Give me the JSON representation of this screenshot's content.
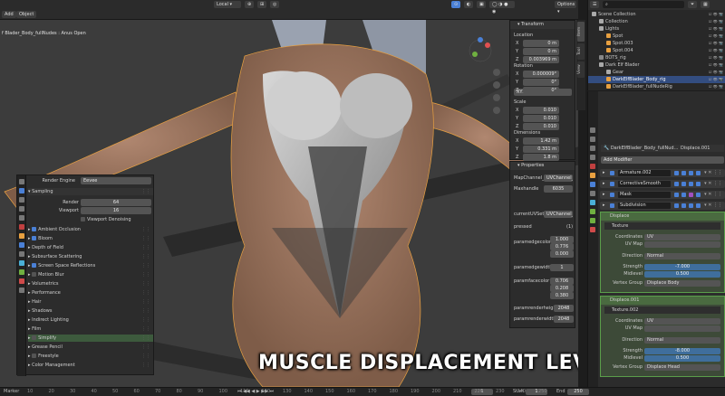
{
  "header": {
    "menu_add": "Add",
    "menu_object": "Object",
    "transform_orientation": "Local",
    "options_label": "Options"
  },
  "viewport": {
    "object_label": "f Blader_Body_fullNudes : Anus Open"
  },
  "render_panel": {
    "engine_label": "Render Engine",
    "engine_value": "Eevee",
    "sampling_header": "Sampling",
    "render_label": "Render",
    "render_value": "64",
    "viewport_label": "Viewport",
    "viewport_value": "16",
    "denoising_label": "Viewport Denoising",
    "sections": [
      {
        "label": "Ambient Occlusion",
        "check": true
      },
      {
        "label": "Bloom",
        "check": true
      },
      {
        "label": "Depth of Field",
        "check": null
      },
      {
        "label": "Subsurface Scattering",
        "check": null
      },
      {
        "label": "Screen Space Reflections",
        "check": true
      },
      {
        "label": "Motion Blur",
        "check": false
      },
      {
        "label": "Volumetrics",
        "check": null
      },
      {
        "label": "Performance",
        "check": null
      },
      {
        "label": "Hair",
        "check": null
      },
      {
        "label": "Shadows",
        "check": null
      },
      {
        "label": "Indirect Lighting",
        "check": null
      },
      {
        "label": "Film",
        "check": null
      },
      {
        "label": "Simplify",
        "check": false,
        "highlight": true
      },
      {
        "label": "Grease Pencil",
        "check": null
      },
      {
        "label": "Freestyle",
        "check": false
      },
      {
        "label": "Color Management",
        "check": null
      }
    ]
  },
  "transform_panel": {
    "title": "Transform",
    "location_label": "Location",
    "location": [
      {
        "axis": "X",
        "value": "0 m"
      },
      {
        "axis": "Y",
        "value": "0 m"
      },
      {
        "axis": "Z",
        "value": "0.003969 m"
      }
    ],
    "rotation_label": "Rotation",
    "rotation": [
      {
        "axis": "X",
        "value": "0.000009°"
      },
      {
        "axis": "Y",
        "value": "0°"
      },
      {
        "axis": "Z",
        "value": "0°"
      }
    ],
    "euler_label": "XYZ Euler",
    "scale_label": "Scale",
    "scale": [
      {
        "axis": "X",
        "value": "0.010"
      },
      {
        "axis": "Y",
        "value": "0.010"
      },
      {
        "axis": "Z",
        "value": "0.010"
      }
    ],
    "dimensions_label": "Dimensions",
    "dimensions": [
      {
        "axis": "X",
        "value": "1.42 m"
      },
      {
        "axis": "Y",
        "value": "0.331 m"
      },
      {
        "axis": "Z",
        "value": "1.8 m"
      }
    ]
  },
  "properties_panel": {
    "title": "Properties",
    "map_channel_label": "MapChannel_1",
    "map_channel_value": "UVChannel_1",
    "max_handle_label": "Maxhandle",
    "max_handle_value": "6035",
    "current_uvset_label": "currentUVSet",
    "current_uvset_value": "UVChannel_1",
    "pressed_label": "pressed",
    "pressed_value": "(1)",
    "param_model_color_label": "paramedgecolor",
    "param_model_color": [
      "1.000",
      "0.776",
      "0.000"
    ],
    "param_edge_width_label": "paramedgewidth",
    "param_edge_width_value": "1",
    "param_face_color_label": "paramfacecolor",
    "param_face_color": [
      "0.706",
      "0.208",
      "0.380"
    ],
    "param_render_height_label": "paramrenderheight",
    "param_render_height_value": "2048",
    "param_render_width_label": "paramrenderwidth",
    "param_render_width_value": "2048"
  },
  "npanel_tabs": [
    "Item",
    "Tool",
    "View"
  ],
  "outliner": {
    "rows": [
      {
        "label": "Scene Collection",
        "indent": 0,
        "color": "#aaaaaa"
      },
      {
        "label": "Collection",
        "indent": 1,
        "color": "#aaaaaa"
      },
      {
        "label": "Lights",
        "indent": 1,
        "color": "#aaaaaa"
      },
      {
        "label": "Spot",
        "indent": 2,
        "color": "#e8a040"
      },
      {
        "label": "Spot.003",
        "indent": 2,
        "color": "#e8a040"
      },
      {
        "label": "Spot.004",
        "indent": 2,
        "color": "#e8a040"
      },
      {
        "label": "BOTS_rig",
        "indent": 1,
        "color": "#888888"
      },
      {
        "label": "Dark Elf Blader",
        "indent": 1,
        "color": "#aaaaaa"
      },
      {
        "label": "Gear",
        "indent": 2,
        "color": "#aaaaaa"
      },
      {
        "label": "DarkElfBlader_Body_rig",
        "indent": 2,
        "color": "#e8a040",
        "selected": true
      },
      {
        "label": "DarkElfBlader_fullNudeRig",
        "indent": 2,
        "color": "#e8a040"
      }
    ]
  },
  "modifiers": {
    "object_name": "DarkElfBlader_Body_fullNud...",
    "modifier_ref": "Displace.001",
    "add_modifier_label": "Add Modifier",
    "stack": [
      "Armature.002",
      "CorrectiveSmooth",
      "Mask",
      "Subdivision"
    ],
    "displace_1": {
      "name": "Displace",
      "texture_label": "Texture",
      "coordinates_label": "Coordinates",
      "coordinates_value": "UV",
      "uvmap_label": "UV Map",
      "direction_label": "Direction",
      "direction_value": "Normal",
      "strength_label": "Strength",
      "strength_value": "-7.000",
      "midlevel_label": "Midlevel",
      "midlevel_value": "0.500",
      "vgroup_label": "Vertex Group",
      "vgroup_value": "Displace Body"
    },
    "displace_2": {
      "name": "Displace.001",
      "texture_label": "Texture.002",
      "coordinates_label": "Coordinates",
      "coordinates_value": "UV",
      "uvmap_label": "UV Map",
      "direction_label": "Direction",
      "direction_value": "Normal",
      "strength_label": "Strength",
      "strength_value": "-8.000",
      "midlevel_label": "Midlevel",
      "midlevel_value": "0.500",
      "vgroup_label": "Vertex Group",
      "vgroup_value": "Displace Head"
    }
  },
  "timeline": {
    "marker_label": "Marker",
    "ticks": [
      "10",
      "20",
      "30",
      "40",
      "50",
      "60",
      "70",
      "80",
      "90",
      "100",
      "110",
      "120",
      "130",
      "140",
      "150",
      "160",
      "170",
      "180",
      "190",
      "200",
      "210",
      "220",
      "230",
      "240",
      "250"
    ],
    "frame_current": "1",
    "start_label": "Start",
    "start_value": "1",
    "end_label": "End",
    "end_value": "250"
  },
  "caption": "MUSCLE DISPLACEMENT LEVEL"
}
